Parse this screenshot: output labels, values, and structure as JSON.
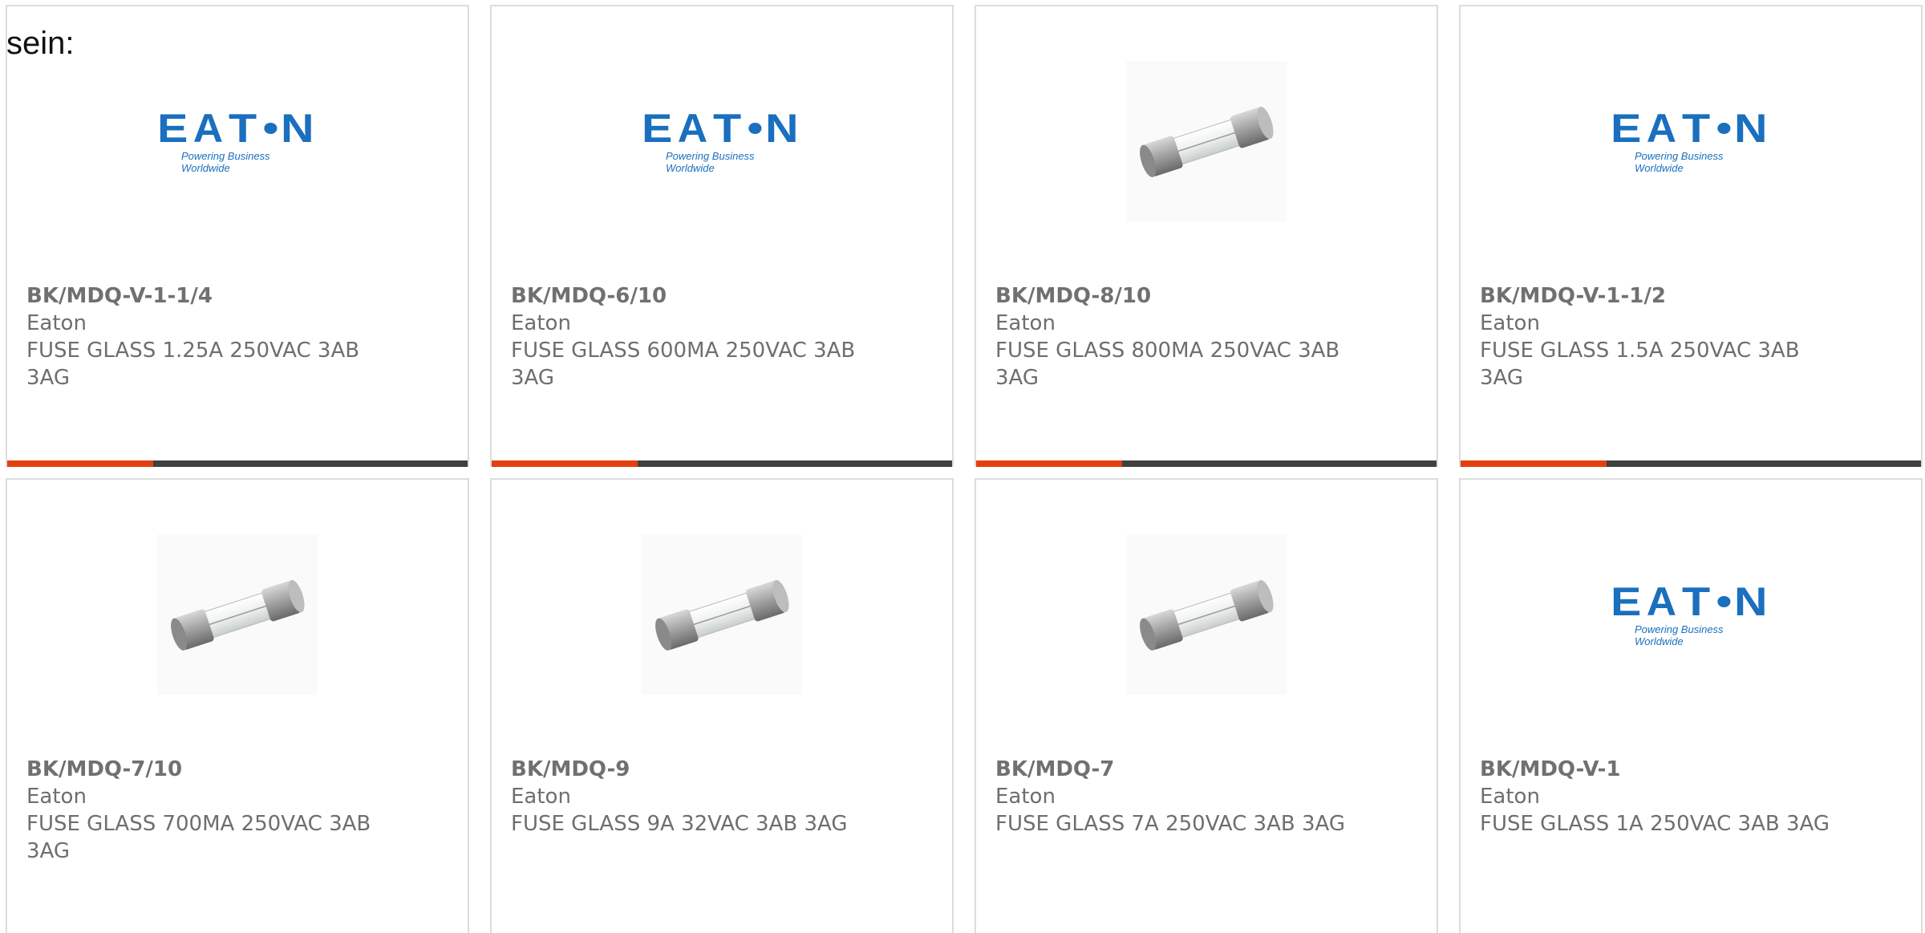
{
  "intro": {
    "text": "sein:"
  },
  "products": [
    {
      "part": "BK/MDQ-V-1-1/4",
      "brand": "Eaton",
      "desc_line1": "FUSE GLASS 1.25A 250VAC 3AB",
      "desc_line2": "3AG",
      "image": "eaton-logo"
    },
    {
      "part": "BK/MDQ-6/10",
      "brand": "Eaton",
      "desc_line1": "FUSE GLASS 600MA 250VAC 3AB",
      "desc_line2": "3AG",
      "image": "eaton-logo"
    },
    {
      "part": "BK/MDQ-8/10",
      "brand": "Eaton",
      "desc_line1": "FUSE GLASS 800MA 250VAC 3AB",
      "desc_line2": "3AG",
      "image": "glass-fuse"
    },
    {
      "part": "BK/MDQ-V-1-1/2",
      "brand": "Eaton",
      "desc_line1": "FUSE GLASS 1.5A 250VAC 3AB",
      "desc_line2": "3AG",
      "image": "eaton-logo"
    },
    {
      "part": "BK/MDQ-7/10",
      "brand": "Eaton",
      "desc_line1": "FUSE GLASS 700MA 250VAC 3AB",
      "desc_line2": "3AG",
      "image": "glass-fuse"
    },
    {
      "part": "BK/MDQ-9",
      "brand": "Eaton",
      "desc_line1": "FUSE GLASS 9A 32VAC 3AB 3AG",
      "desc_line2": "",
      "image": "glass-fuse"
    },
    {
      "part": "BK/MDQ-7",
      "brand": "Eaton",
      "desc_line1": "FUSE GLASS 7A 250VAC 3AB 3AG",
      "desc_line2": "",
      "image": "glass-fuse"
    },
    {
      "part": "BK/MDQ-V-1",
      "brand": "Eaton",
      "desc_line1": "FUSE GLASS 1A 250VAC 3AB 3AG",
      "desc_line2": "",
      "image": "eaton-logo"
    }
  ],
  "logo": {
    "word": "E T N",
    "tagline": "Powering Business Worldwide"
  },
  "colors": {
    "accent": "#e2400f",
    "bar": "#404040",
    "eaton_blue": "#1a6fbe",
    "text": "#6e6e6e",
    "border": "#dcdcdc"
  }
}
